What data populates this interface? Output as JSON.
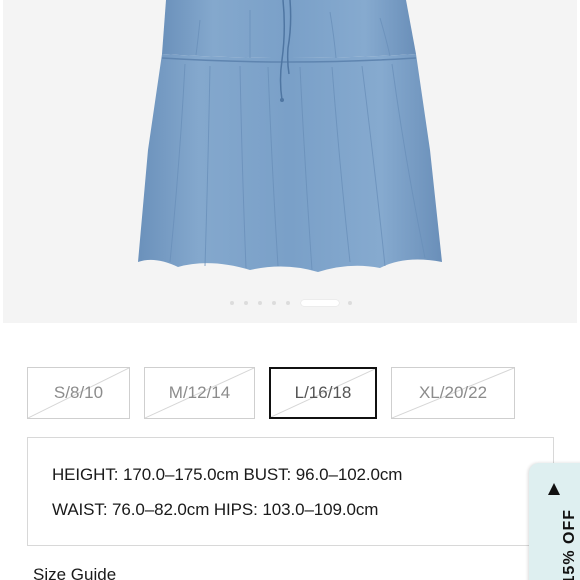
{
  "gallery": {
    "image_alt": "Blue tiered denim-look skirt with drawstring",
    "slide_count": 7,
    "active_slide": 6
  },
  "sizes": [
    {
      "label": "S/8/10",
      "available": false,
      "selected": false
    },
    {
      "label": "M/12/14",
      "available": false,
      "selected": false
    },
    {
      "label": "L/16/18",
      "available": false,
      "selected": true
    },
    {
      "label": "XL/20/22",
      "available": false,
      "selected": false
    }
  ],
  "measurements": {
    "line1": "HEIGHT: 170.0–175.0cm   BUST: 96.0–102.0cm",
    "line2": "WAIST: 76.0–82.0cm   HIPS: 103.0–109.0cm"
  },
  "size_guide_label": "Size Guide",
  "discount_tab": {
    "label": "15% OFF",
    "icon": "triangle-up-icon",
    "background": "#deeff0"
  },
  "colors": {
    "skirt": "#7fa3c9",
    "selected_border": "#111111",
    "unavailable_text": "#8c8c8c"
  }
}
